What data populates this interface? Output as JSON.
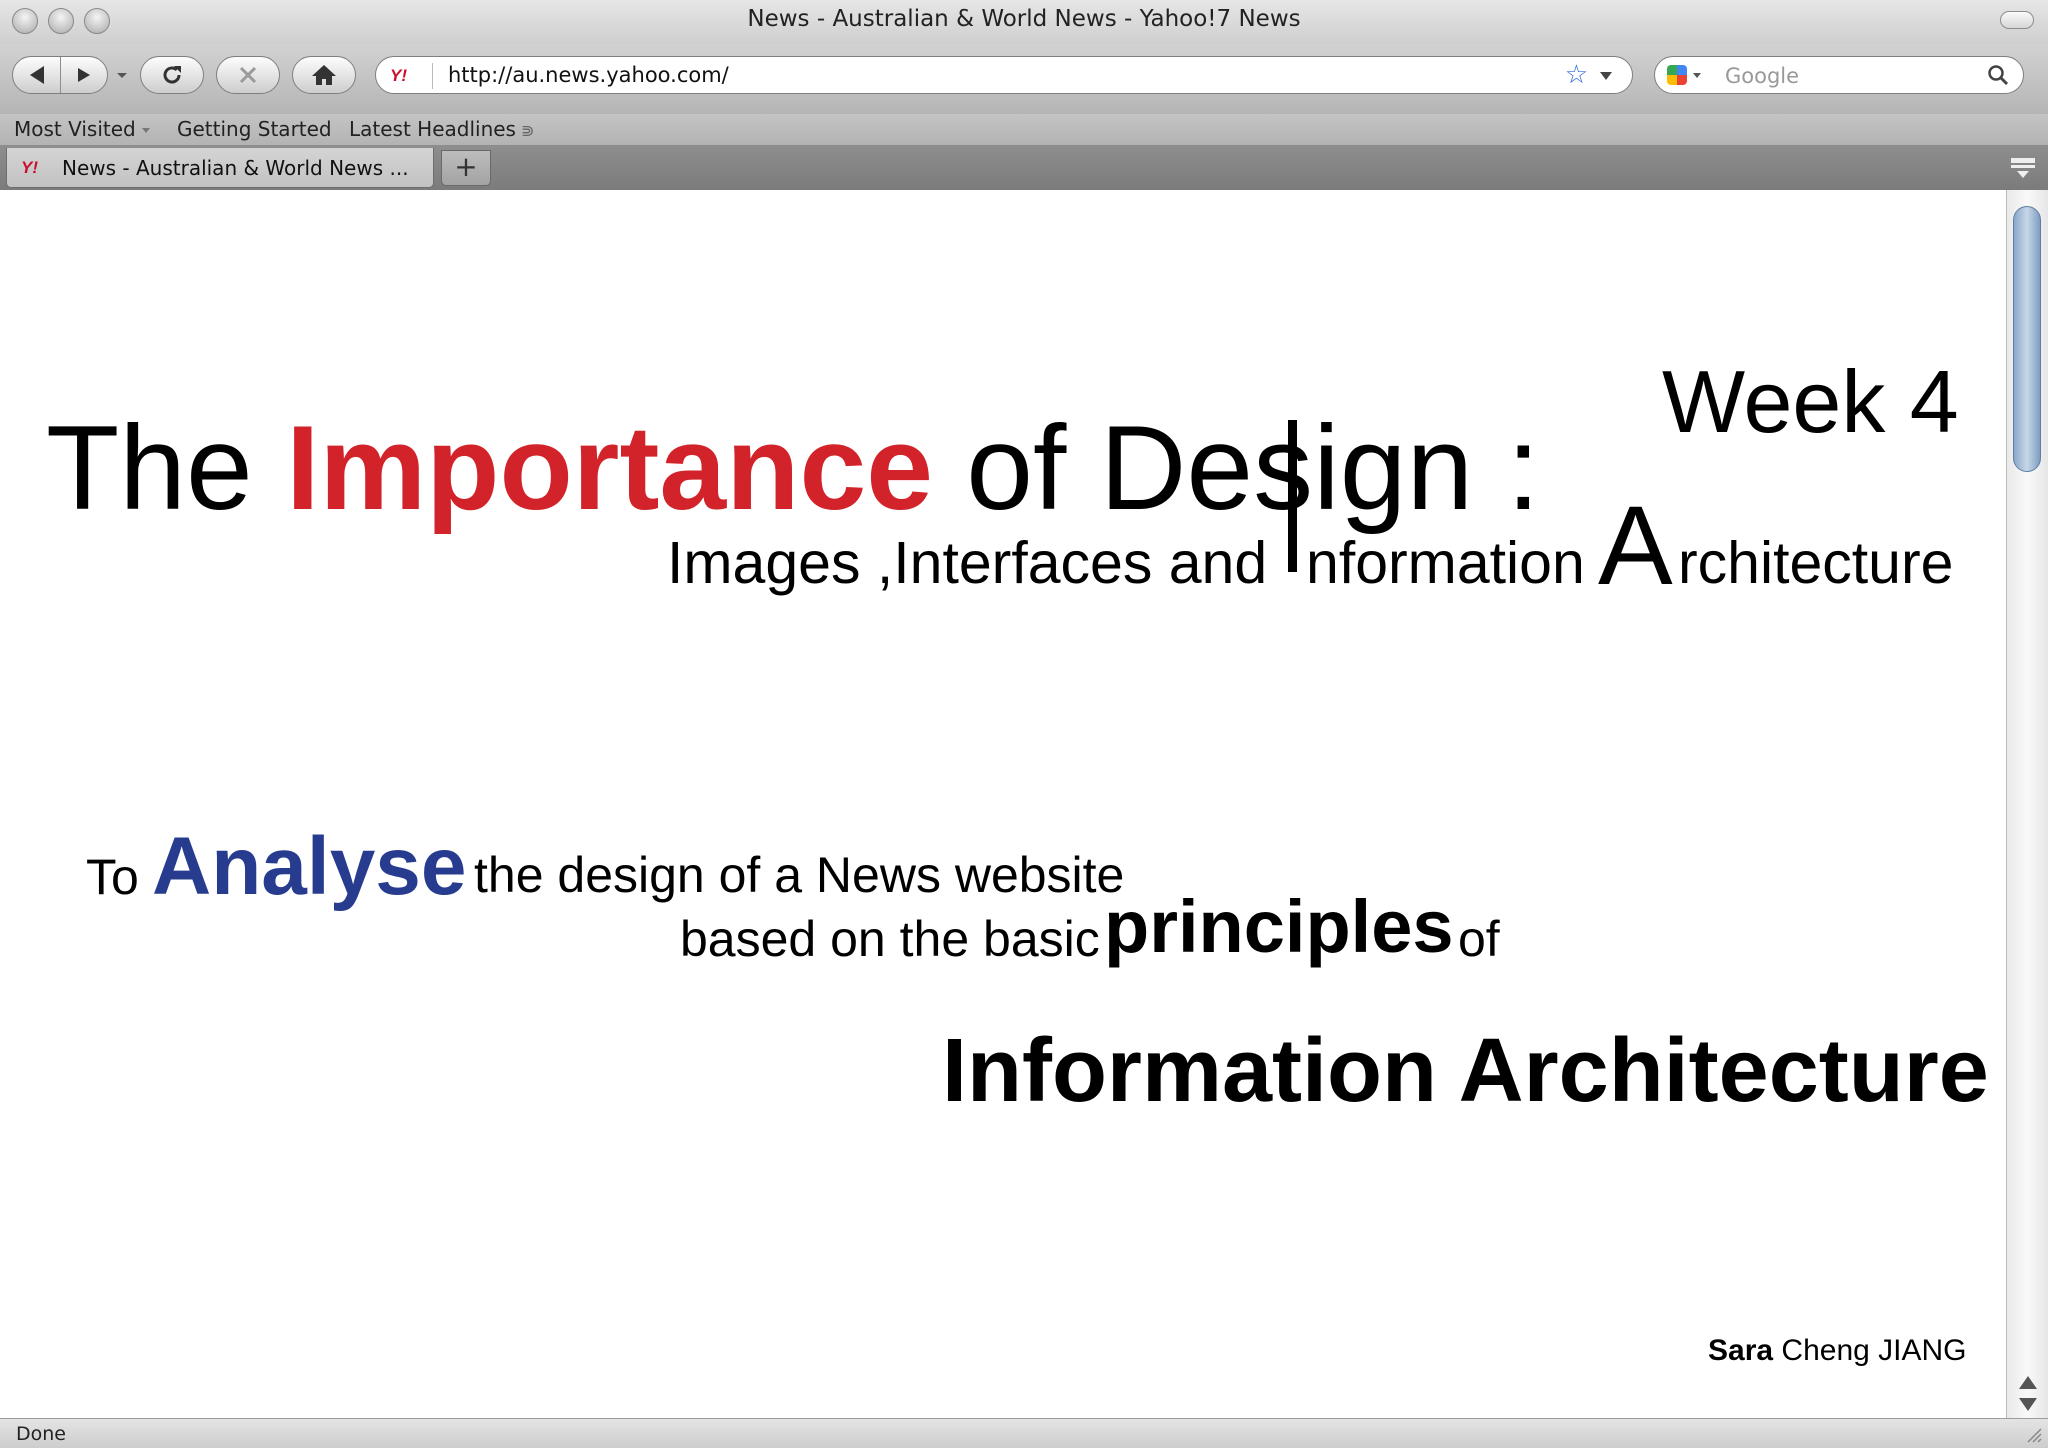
{
  "window": {
    "title": "News - Australian & World News - Yahoo!7 News"
  },
  "toolbar": {
    "url": "http://au.news.yahoo.com/",
    "site_favicon": "Y!",
    "search_placeholder": "Google"
  },
  "bookmarks": [
    "Most Visited",
    "Getting Started",
    "Latest Headlines"
  ],
  "tab": {
    "title": "News - Australian & World News ...",
    "favicon": "Y!"
  },
  "slide": {
    "week": "Week 4",
    "title_the": "The",
    "title_importance": "Importance",
    "title_of_design": "of Design :",
    "subtitle_images": "Images ,Interfaces and",
    "subtitle_information": "nformation",
    "subtitle_A": "A",
    "subtitle_rchitecture": "rchitecture",
    "line1_to": "To",
    "line1_analyse": "Analyse",
    "line1_rest": "the design of a News website",
    "line2_pre": "based on the basic",
    "line2_principles": "principles",
    "line2_of": "of",
    "ia_heading": "Information Architecture",
    "author_first": "Sara",
    "author_rest": "Cheng JIANG"
  },
  "status": {
    "text": "Done"
  },
  "colors": {
    "importance": "#d2232a",
    "analyse": "#283c8f"
  }
}
